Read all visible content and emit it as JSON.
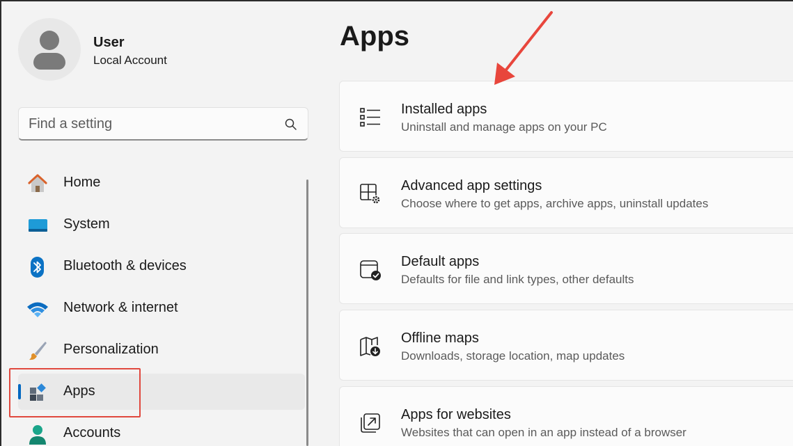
{
  "profile": {
    "name": "User",
    "account_type": "Local Account"
  },
  "search": {
    "placeholder": "Find a setting"
  },
  "nav": {
    "items": [
      {
        "label": "Home",
        "icon": "home-icon"
      },
      {
        "label": "System",
        "icon": "monitor-icon"
      },
      {
        "label": "Bluetooth & devices",
        "icon": "bluetooth-icon"
      },
      {
        "label": "Network & internet",
        "icon": "wifi-icon"
      },
      {
        "label": "Personalization",
        "icon": "paintbrush-icon"
      },
      {
        "label": "Apps",
        "icon": "apps-icon",
        "selected": true
      },
      {
        "label": "Accounts",
        "icon": "person-icon"
      }
    ]
  },
  "main": {
    "title": "Apps",
    "cards": [
      {
        "title": "Installed apps",
        "subtitle": "Uninstall and manage apps on your PC",
        "icon": "list-icon"
      },
      {
        "title": "Advanced app settings",
        "subtitle": "Choose where to get apps, archive apps, uninstall updates",
        "icon": "app-gear-icon"
      },
      {
        "title": "Default apps",
        "subtitle": "Defaults for file and link types, other defaults",
        "icon": "window-check-icon"
      },
      {
        "title": "Offline maps",
        "subtitle": "Downloads, storage location, map updates",
        "icon": "map-download-icon"
      },
      {
        "title": "Apps for websites",
        "subtitle": "Websites that can open in an app instead of a browser",
        "icon": "open-external-icon"
      }
    ]
  },
  "colors": {
    "accent": "#0067c0",
    "annotation": "#e0483e"
  }
}
